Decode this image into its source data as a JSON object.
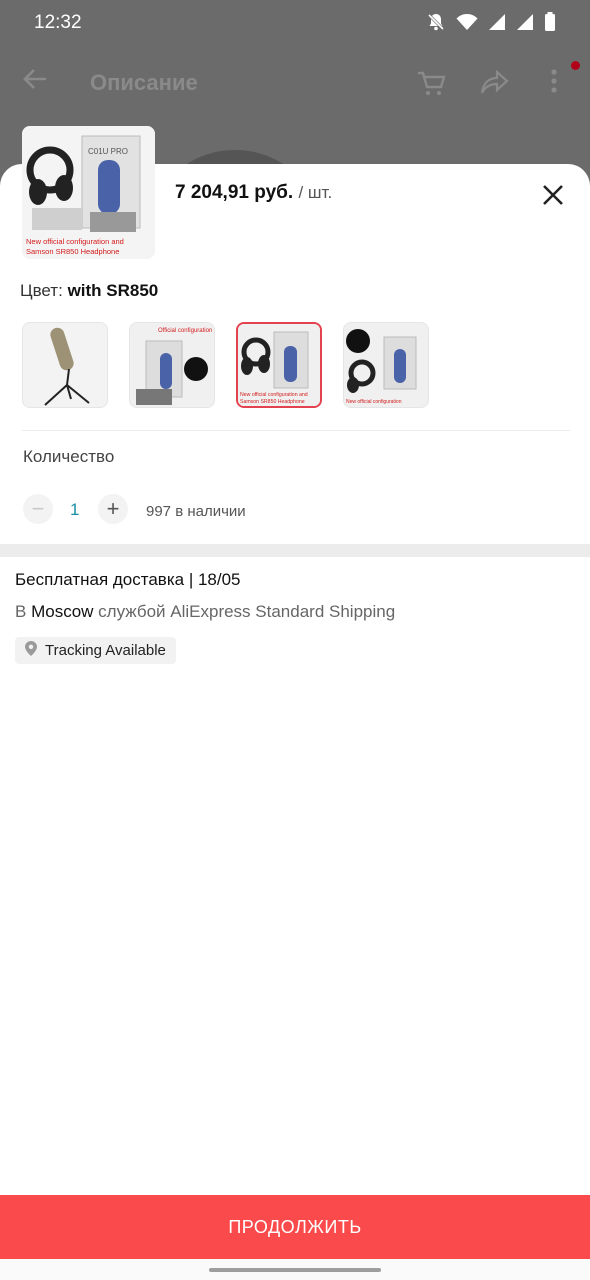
{
  "status_bar": {
    "time": "12:32"
  },
  "background_page": {
    "title": "Описание"
  },
  "sheet": {
    "price": "7 204,91 руб.",
    "unit": "/ шт.",
    "color_label": "Цвет:",
    "color_value": "with SR850",
    "product_image_text": [
      "C01U PRO",
      "New official configuration and",
      "Samson SR850 Headphone"
    ],
    "variants": [
      {
        "name": "microphone-on-tripod",
        "selected": false,
        "caption": ""
      },
      {
        "name": "mic-with-windscreen",
        "selected": false,
        "caption": "Official configuration"
      },
      {
        "name": "mic-with-sr850",
        "selected": true,
        "caption": "New official configuration and Samson SR850 Headphone"
      },
      {
        "name": "mic-with-sr850-and-windscreen",
        "selected": false,
        "caption": "New official configuration"
      }
    ],
    "quantity_label": "Количество",
    "quantity_minus": "−",
    "quantity_value": "1",
    "quantity_plus": "+",
    "stock": "997 в наличии",
    "delivery_title": "Бесплатная доставка | 18/05",
    "delivery_prefix": "В",
    "delivery_city": "Moscow",
    "delivery_suffix": "службой AliExpress Standard Shipping",
    "tracking": "Tracking Available",
    "continue": "ПРОДОЛЖИТЬ"
  },
  "colors": {
    "accent": "#fa4a4c",
    "selected_border": "#e3424f",
    "quantity": "#1a8fa8"
  }
}
